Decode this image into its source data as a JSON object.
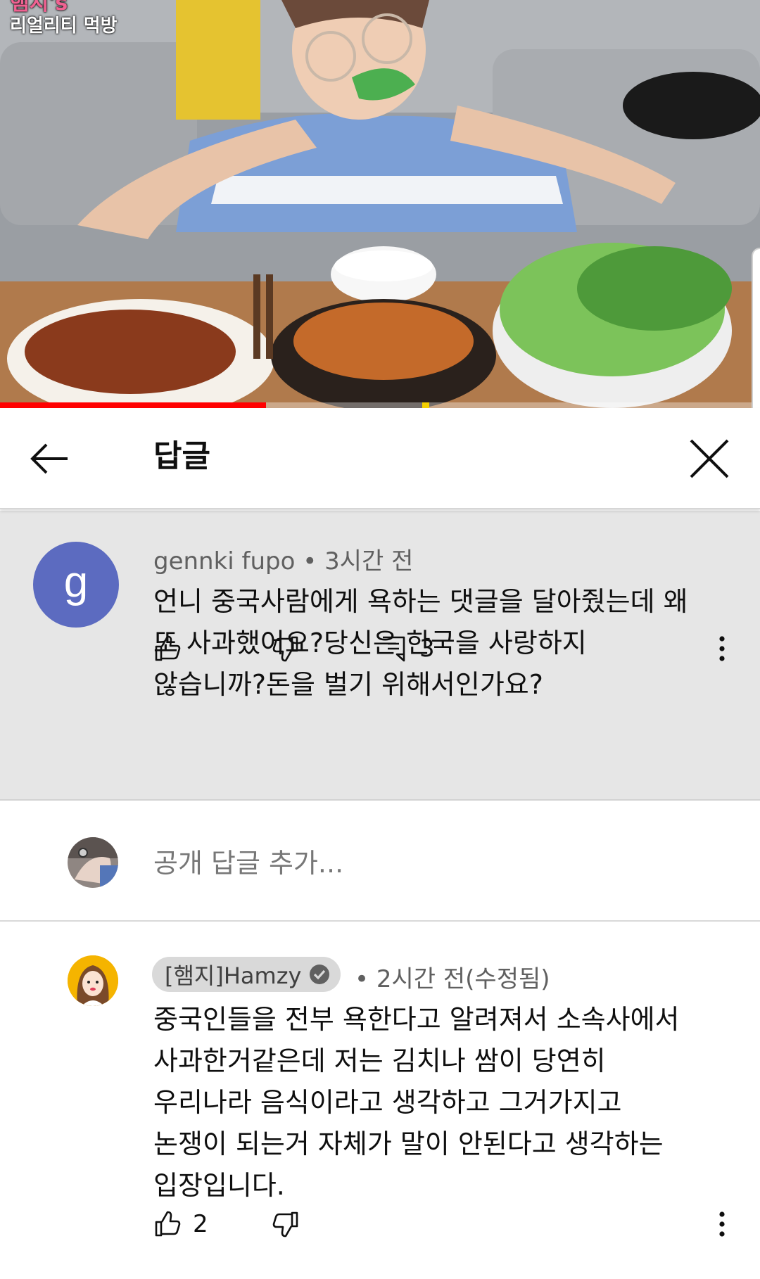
{
  "video": {
    "channel_name": "햄지's",
    "channel_subtitle": "리얼리티 먹방",
    "progress": 0.35
  },
  "header": {
    "title": "답글"
  },
  "parent_comment": {
    "avatar_letter": "g",
    "avatar_color": "#5c6bc0",
    "author": "gennki fupo",
    "time": "3시간 전",
    "text": "언니 중국사람에게 욕하는 댓글을 달아줬는데 왜\n또 사과했어요?당신은 한국을 사랑하지\n않습니까?돈을 벌기 위해서인가요?",
    "reply_count": "3",
    "icons": [
      "thumb-up-icon",
      "thumb-down-icon",
      "reply-icon",
      "more-vert-icon"
    ]
  },
  "add_reply": {
    "placeholder": "공개 답글 추가..."
  },
  "creator_reply": {
    "author": "[햄지]Hamzy",
    "time": "2시간 전(수정됨)",
    "text": "중국인들을 전부 욕한다고 알려져서 소속사에서\n사과한거같은데 저는 김치나 쌈이 당연히\n우리나라 음식이라고 생각하고 그거가지고\n논쟁이 되는거 자체가 말이 안된다고 생각하는\n입장입니다.",
    "like_count": "2",
    "avatar_color": "#f5b400"
  },
  "colors": {
    "accent_red": "#ff0000",
    "parent_bg": "#e6e6e6",
    "meta_gray": "#606060"
  }
}
